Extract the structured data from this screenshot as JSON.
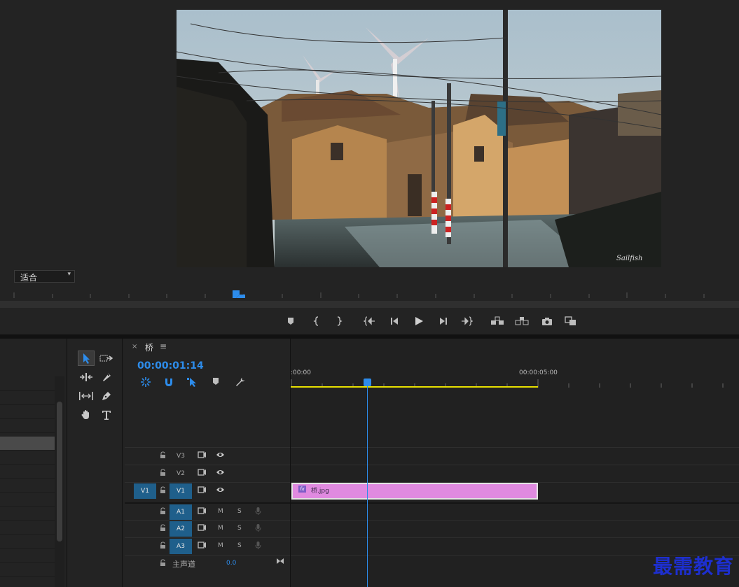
{
  "monitor": {
    "fit_label": "适合",
    "preview_signature": "Sailfish"
  },
  "timeline": {
    "tab_name": "桥",
    "timecode": "00:00:01:14",
    "ruler": {
      "start": ":00:00",
      "mark": "00:00:05:00"
    },
    "tracks": {
      "video": [
        {
          "name": "V3",
          "source": ""
        },
        {
          "name": "V2",
          "source": ""
        },
        {
          "name": "V1",
          "source": "V1"
        }
      ],
      "audio": [
        {
          "name": "A1",
          "mute": "M",
          "solo": "S"
        },
        {
          "name": "A2",
          "mute": "M",
          "solo": "S"
        },
        {
          "name": "A3",
          "mute": "M",
          "solo": "S"
        }
      ],
      "master": {
        "label": "主声道",
        "value": "0.0"
      }
    },
    "clip": {
      "label": "桥.jpg",
      "fx": "fx"
    }
  },
  "watermark": "最需教育",
  "colors": {
    "accent": "#2d8ceb",
    "clip": "#e08ae0",
    "work_area": "#e8e100",
    "track_on": "#1f5f8b"
  }
}
